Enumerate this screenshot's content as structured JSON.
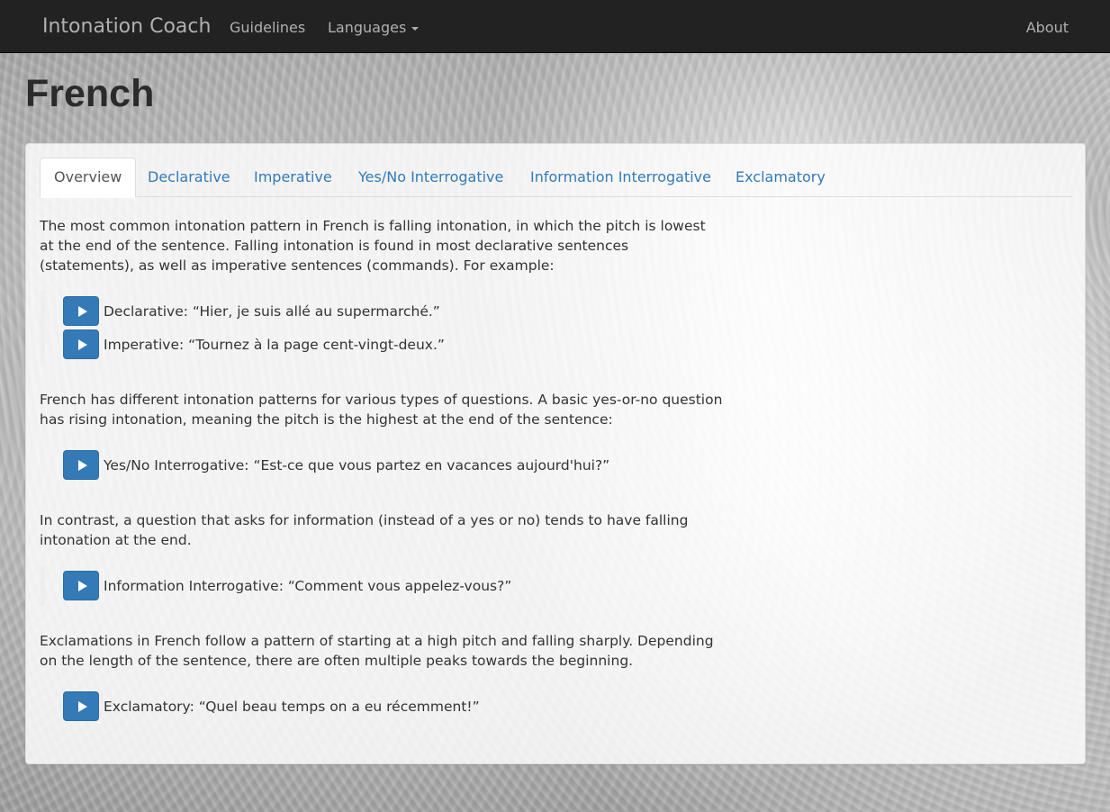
{
  "navbar": {
    "brand": "Intonation Coach",
    "links": {
      "guidelines": "Guidelines",
      "languages": "Languages",
      "about": "About"
    }
  },
  "page": {
    "title": "French"
  },
  "tabs": [
    {
      "label": "Overview",
      "active": true
    },
    {
      "label": "Declarative",
      "active": false
    },
    {
      "label": "Imperative",
      "active": false
    },
    {
      "label": "Yes/No Interrogative",
      "active": false
    },
    {
      "label": "Information Interrogative",
      "active": false
    },
    {
      "label": "Exclamatory",
      "active": false
    }
  ],
  "overview": {
    "intro": "The most common intonation pattern in French is falling intonation, in which the pitch is lowest at the end of the sentence. Falling intonation is found in most declarative sentences (statements), as well as imperative sentences (commands). For example:",
    "examples_falling": [
      "Declarative: “Hier, je suis allé au supermarché.”",
      "Imperative: “Tournez à la page cent-vingt-deux.”"
    ],
    "questions_intro": "French has different intonation patterns for various types of questions. A basic yes-or-no question has rising intonation, meaning the pitch is the highest at the end of the sentence:",
    "example_yesno": "Yes/No Interrogative: “Est-ce que vous partez en vacances aujourd'hui?”",
    "info_intro": "In contrast, a question that asks for information (instead of a yes or no) tends to have falling intonation at the end.",
    "example_info": "Information Interrogative: “Comment vous appelez-vous?”",
    "excl_intro": "Exclamations in French follow a pattern of starting at a high pitch and falling sharply. Depending on the length of the sentence, there are often multiple peaks towards the beginning.",
    "example_excl": "Exclamatory: “Quel beau temps on a eu récemment!”"
  },
  "colors": {
    "navbar_bg": "#222222",
    "link": "#337ab7",
    "play_button": "#337ab7"
  },
  "icons": {
    "play": "play-icon",
    "dropdown": "caret-down-icon"
  }
}
